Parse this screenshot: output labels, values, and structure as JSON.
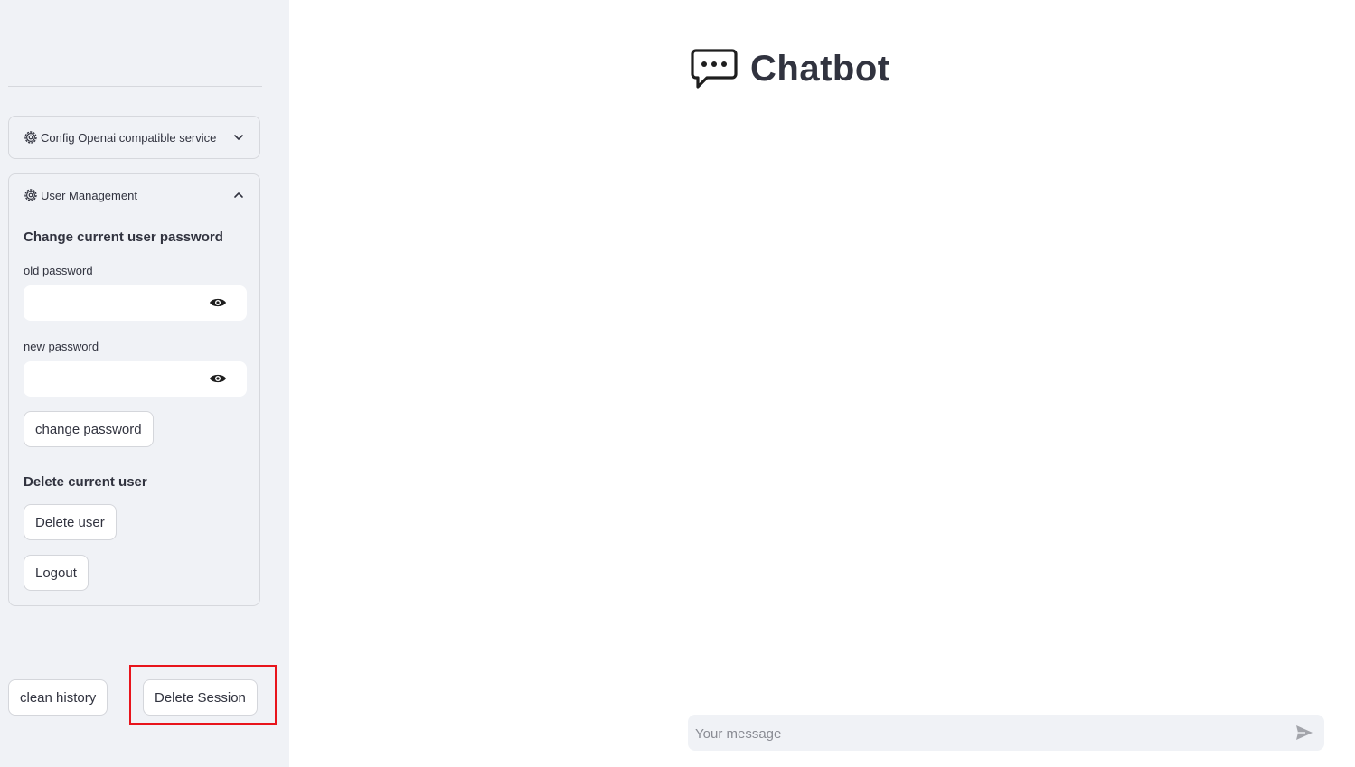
{
  "app": {
    "title": "Chatbot",
    "title_icon": "chat-bubble-icon"
  },
  "sidebar": {
    "config_expander": {
      "label": "Config Openai compatible service",
      "icon": "gear-icon",
      "expanded": false
    },
    "user_expander": {
      "label": "User Management",
      "icon": "gear-icon",
      "expanded": true,
      "change_password": {
        "heading": "Change current user password",
        "old_label": "old password",
        "old_value": "",
        "new_label": "new password",
        "new_value": "",
        "submit_label": "change password"
      },
      "delete_user": {
        "heading": "Delete current user",
        "button_label": "Delete user"
      },
      "logout_label": "Logout"
    },
    "clean_history_label": "clean history",
    "delete_session_label": "Delete Session"
  },
  "chat": {
    "placeholder": "Your message",
    "value": ""
  },
  "colors": {
    "sidebar_bg": "#f0f2f6",
    "text": "#31333f",
    "highlight": "#e8141c"
  }
}
